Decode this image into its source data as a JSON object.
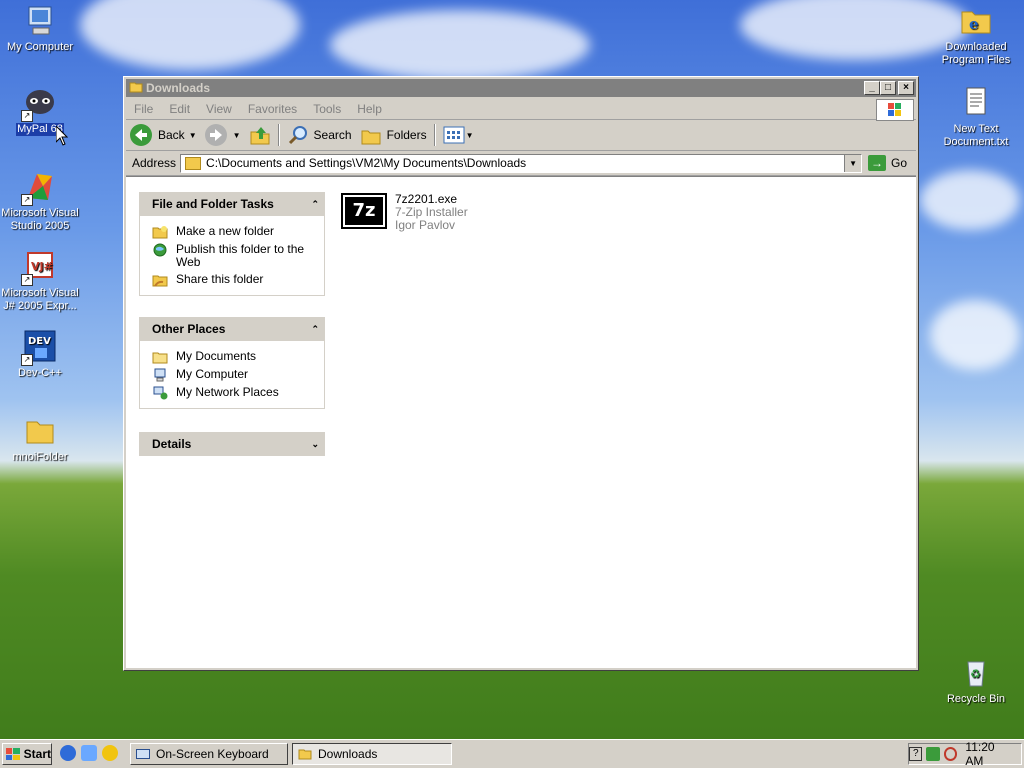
{
  "desktop": {
    "icons": [
      {
        "label": "My Computer",
        "icon": "my-computer-icon"
      },
      {
        "label": "MyPal 68",
        "icon": "mypal-icon",
        "selected": true
      },
      {
        "label": "Microsoft Visual Studio 2005",
        "icon": "visual-studio-icon"
      },
      {
        "label": "Microsoft Visual J# 2005 Expr...",
        "icon": "visual-jsharp-icon"
      },
      {
        "label": "Dev-C++",
        "icon": "dev-cpp-icon"
      },
      {
        "label": "mnoiFolder",
        "icon": "folder-icon"
      },
      {
        "label": "Downloaded Program Files",
        "icon": "ie-folder-icon"
      },
      {
        "label": "New Text Document.txt",
        "icon": "text-document-icon"
      },
      {
        "label": "Recycle Bin",
        "icon": "recycle-bin-icon"
      }
    ]
  },
  "window": {
    "title": "Downloads",
    "menu": [
      "File",
      "Edit",
      "View",
      "Favorites",
      "Tools",
      "Help"
    ],
    "toolbar": {
      "back": "Back",
      "search": "Search",
      "folders": "Folders"
    },
    "address": {
      "label": "Address",
      "value": "C:\\Documents and Settings\\VM2\\My Documents\\Downloads",
      "go": "Go"
    },
    "panels": {
      "tasks": {
        "title": "File and Folder Tasks",
        "items": [
          "Make a new folder",
          "Publish this folder to the Web",
          "Share this folder"
        ]
      },
      "places": {
        "title": "Other Places",
        "items": [
          "My Documents",
          "My Computer",
          "My Network Places"
        ]
      },
      "details": {
        "title": "Details"
      }
    },
    "file": {
      "name": "7z2201.exe",
      "description": "7-Zip Installer",
      "company": "Igor Pavlov",
      "icon_text": "7z"
    }
  },
  "taskbar": {
    "start": "Start",
    "buttons": [
      "On-Screen Keyboard",
      "Downloads"
    ],
    "clock": "11:20 AM"
  },
  "colors": {
    "titlebar_inactive": "#808080",
    "selection": "#1c3ea8",
    "face": "#d4d0c8"
  }
}
